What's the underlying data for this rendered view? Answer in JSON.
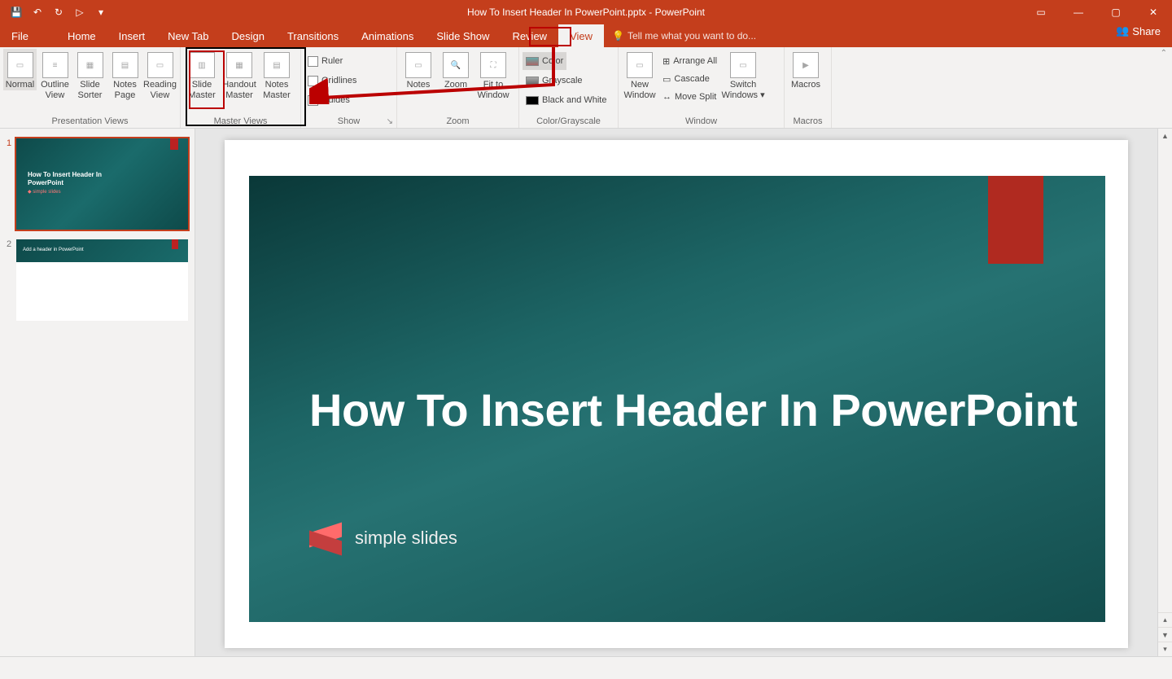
{
  "title": "How To Insert Header In PowerPoint.pptx - PowerPoint",
  "qat": {
    "save": "💾",
    "undo": "↶",
    "redo": "↻",
    "start": "▷"
  },
  "win": {
    "opts": "▭",
    "min": "—",
    "max": "▢",
    "close": "✕"
  },
  "tabs": {
    "file": "File",
    "items": [
      "Home",
      "Insert",
      "New Tab",
      "Design",
      "Transitions",
      "Animations",
      "Slide Show",
      "Review",
      "View"
    ],
    "active": "View",
    "tellme_icon": "💡",
    "tellme": "Tell me what you want to do...",
    "share_icon": "👥",
    "share": "Share"
  },
  "ribbon": {
    "presentation_views": {
      "label": "Presentation Views",
      "normal": "Normal",
      "outline": "Outline\nView",
      "sorter": "Slide\nSorter",
      "notes_page": "Notes\nPage",
      "reading": "Reading\nView"
    },
    "master_views": {
      "label": "Master Views",
      "slide_master": "Slide\nMaster",
      "handout_master": "Handout\nMaster",
      "notes_master": "Notes\nMaster"
    },
    "show": {
      "label": "Show",
      "ruler": "Ruler",
      "gridlines": "Gridlines",
      "guides": "Guides"
    },
    "zoom": {
      "label": "Zoom",
      "notes": "Notes",
      "zoom": "Zoom",
      "fit": "Fit to\nWindow"
    },
    "color": {
      "label": "Color/Grayscale",
      "color": "Color",
      "grayscale": "Grayscale",
      "bw": "Black and White"
    },
    "window": {
      "label": "Window",
      "new_window": "New\nWindow",
      "arrange": "Arrange All",
      "cascade": "Cascade",
      "move_split": "Move Split",
      "switch": "Switch\nWindows"
    },
    "macros": {
      "label": "Macros",
      "btn": "Macros"
    }
  },
  "thumbs": {
    "s1": {
      "num": "1",
      "title": "How To Insert Header In\nPowerPoint",
      "logo": "simple slides"
    },
    "s2": {
      "num": "2",
      "text": "Add a header in PowerPoint"
    }
  },
  "slide": {
    "title": "How To Insert Header In PowerPoint",
    "logo_text": "simple slides"
  }
}
